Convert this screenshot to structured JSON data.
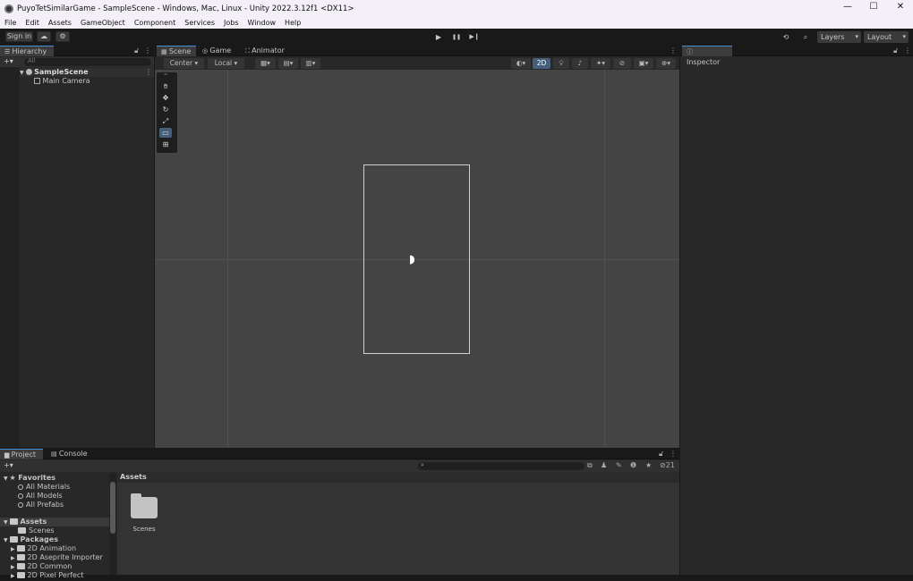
{
  "window": {
    "title": "PuyoTetSimilarGame - SampleScene - Windows, Mac, Linux - Unity 2022.3.12f1 <DX11>",
    "controls": {
      "minimize": "—",
      "maximize": "☐",
      "close": "✕"
    }
  },
  "menu": [
    "File",
    "Edit",
    "Assets",
    "GameObject",
    "Component",
    "Services",
    "Jobs",
    "Window",
    "Help"
  ],
  "toolbar": {
    "sign_in": "Sign in",
    "cloud_icon": "cloud-icon",
    "collab_icon": "gear-icon",
    "play": "▶",
    "pause": "❚❚",
    "step": "▶❙",
    "layers": "Layers",
    "layout": "Layout"
  },
  "hierarchy": {
    "tab": "Hierarchy",
    "search_placeholder": "All",
    "add": "+▾",
    "scene": "SampleScene",
    "items": [
      "Main Camera"
    ]
  },
  "scene_panel": {
    "tabs": [
      "Scene",
      "Game",
      "Animator"
    ],
    "pivot": "Center",
    "space": "Local",
    "mode_2d": "2D",
    "tools": [
      "hand-icon",
      "move-icon",
      "rotate-icon",
      "scale-icon",
      "rect-icon",
      "transform-icon"
    ]
  },
  "inspector": {
    "tab": "Inspector"
  },
  "project": {
    "tabs": [
      "Project",
      "Console"
    ],
    "add": "+▾",
    "hidden_count": "21",
    "breadcrumb": "Assets",
    "favorites": {
      "label": "Favorites",
      "items": [
        "All Materials",
        "All Models",
        "All Prefabs"
      ]
    },
    "assets": {
      "label": "Assets",
      "items": [
        "Scenes"
      ]
    },
    "packages": {
      "label": "Packages",
      "items": [
        "2D Animation",
        "2D Aseprite Importer",
        "2D Common",
        "2D Pixel Perfect"
      ]
    },
    "grid_items": [
      "Scenes"
    ]
  },
  "colors": {
    "accent": "#4a8ed8",
    "panel": "#282828",
    "scene_bg": "#444444",
    "tab_active": "#3c3c3c"
  }
}
